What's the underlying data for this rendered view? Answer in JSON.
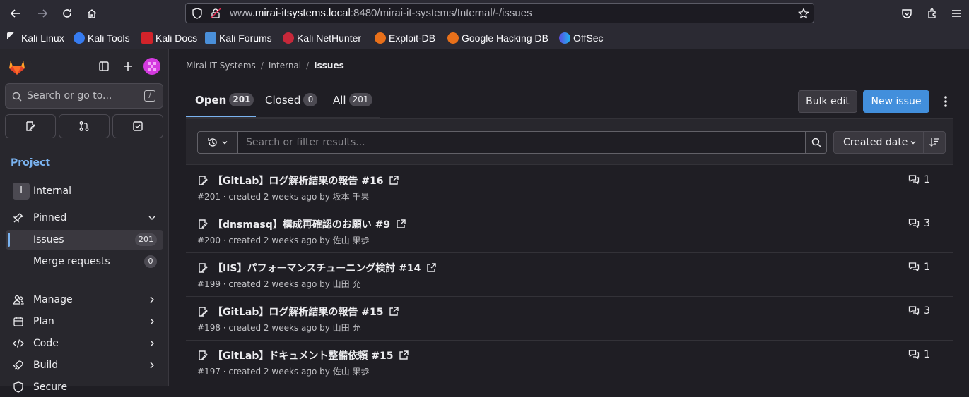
{
  "browser": {
    "url_prefix": "www.",
    "url_host": "mirai-itsystems.local",
    "url_rest": ":8480/mirai-it-systems/Internal/-/issues",
    "bookmarks": [
      {
        "label": "Kali Linux",
        "icon": "kali-dragon-icon"
      },
      {
        "label": "Kali Tools",
        "icon": "kali-tools-icon"
      },
      {
        "label": "Kali Docs",
        "icon": "kali-docs-icon"
      },
      {
        "label": "Kali Forums",
        "icon": "kali-forums-icon"
      },
      {
        "label": "Kali NetHunter",
        "icon": "nethunter-icon"
      },
      {
        "label": "Exploit-DB",
        "icon": "exploit-db-icon"
      },
      {
        "label": "Google Hacking DB",
        "icon": "ghdb-icon"
      },
      {
        "label": "OffSec",
        "icon": "offsec-icon"
      }
    ]
  },
  "sidebar": {
    "search_placeholder": "Search or go to...",
    "search_shortcut": "/",
    "section_title": "Project",
    "project_initial": "I",
    "project_name": "Internal",
    "pinned_label": "Pinned",
    "pinned_items": [
      {
        "label": "Issues",
        "count": "201"
      },
      {
        "label": "Merge requests",
        "count": "0"
      }
    ],
    "menu": [
      {
        "label": "Manage",
        "icon": "users-icon"
      },
      {
        "label": "Plan",
        "icon": "calendar-icon"
      },
      {
        "label": "Code",
        "icon": "code-icon"
      },
      {
        "label": "Build",
        "icon": "rocket-icon"
      },
      {
        "label": "Secure",
        "icon": "shield-icon"
      }
    ]
  },
  "breadcrumb": [
    "Mirai IT Systems",
    "Internal",
    "Issues"
  ],
  "tabs": [
    {
      "label": "Open",
      "count": "201"
    },
    {
      "label": "Closed",
      "count": "0"
    },
    {
      "label": "All",
      "count": "201"
    }
  ],
  "actions": {
    "bulk_edit": "Bulk edit",
    "new_issue": "New issue"
  },
  "filter": {
    "placeholder": "Search or filter results...",
    "sort_label": "Created date"
  },
  "issues": [
    {
      "title": "【GitLab】ログ解析結果の報告 #16",
      "meta": "#201 · created 2 weeks ago by 坂本 千果",
      "comments": "1"
    },
    {
      "title": "【dnsmasq】構成再確認のお願い #9",
      "meta": "#200 · created 2 weeks ago by 佐山 果歩",
      "comments": "3"
    },
    {
      "title": "【IIS】パフォーマンスチューニング検討 #14",
      "meta": "#199 · created 2 weeks ago by 山田 允",
      "comments": "1"
    },
    {
      "title": "【GitLab】ログ解析結果の報告 #15",
      "meta": "#198 · created 2 weeks ago by 山田 允",
      "comments": "3"
    },
    {
      "title": "【GitLab】ドキュメント整備依頼 #15",
      "meta": "#197 · created 2 weeks ago by 佐山 果歩",
      "comments": "1"
    }
  ]
}
